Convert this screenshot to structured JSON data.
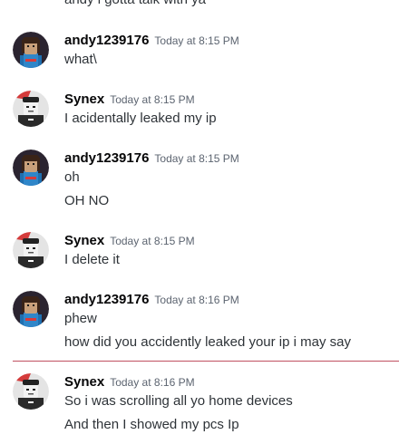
{
  "partial_line": "andy i gotta talk with ya",
  "messages": [
    {
      "username": "andy1239176",
      "timestamp": "Today at 8:15 PM",
      "lines": [
        "what\\"
      ]
    },
    {
      "username": "Synex",
      "timestamp": "Today at 8:15 PM",
      "lines": [
        "I acidentally leaked my ip"
      ]
    },
    {
      "username": "andy1239176",
      "timestamp": "Today at 8:15 PM",
      "lines": [
        "oh",
        "OH NO"
      ]
    },
    {
      "username": "Synex",
      "timestamp": "Today at 8:15 PM",
      "lines": [
        "I delete it"
      ]
    },
    {
      "username": "andy1239176",
      "timestamp": "Today at 8:16 PM",
      "lines": [
        "phew",
        "how did you accidently leaked your ip i may say"
      ]
    },
    {
      "username": "Synex",
      "timestamp": "Today at 8:16 PM",
      "lines": [
        "So i was scrolling all yo home devices",
        "And then I showed my pcs Ip"
      ]
    }
  ],
  "colors": {
    "background": "#ffffff",
    "username": "#060607",
    "timestamp": "#5c6470",
    "text": "#2e3338",
    "new_messages_divider": "#c05060"
  },
  "icons": {
    "andy1239176": "avatar-andy-icon",
    "Synex": "avatar-synex-icon"
  }
}
